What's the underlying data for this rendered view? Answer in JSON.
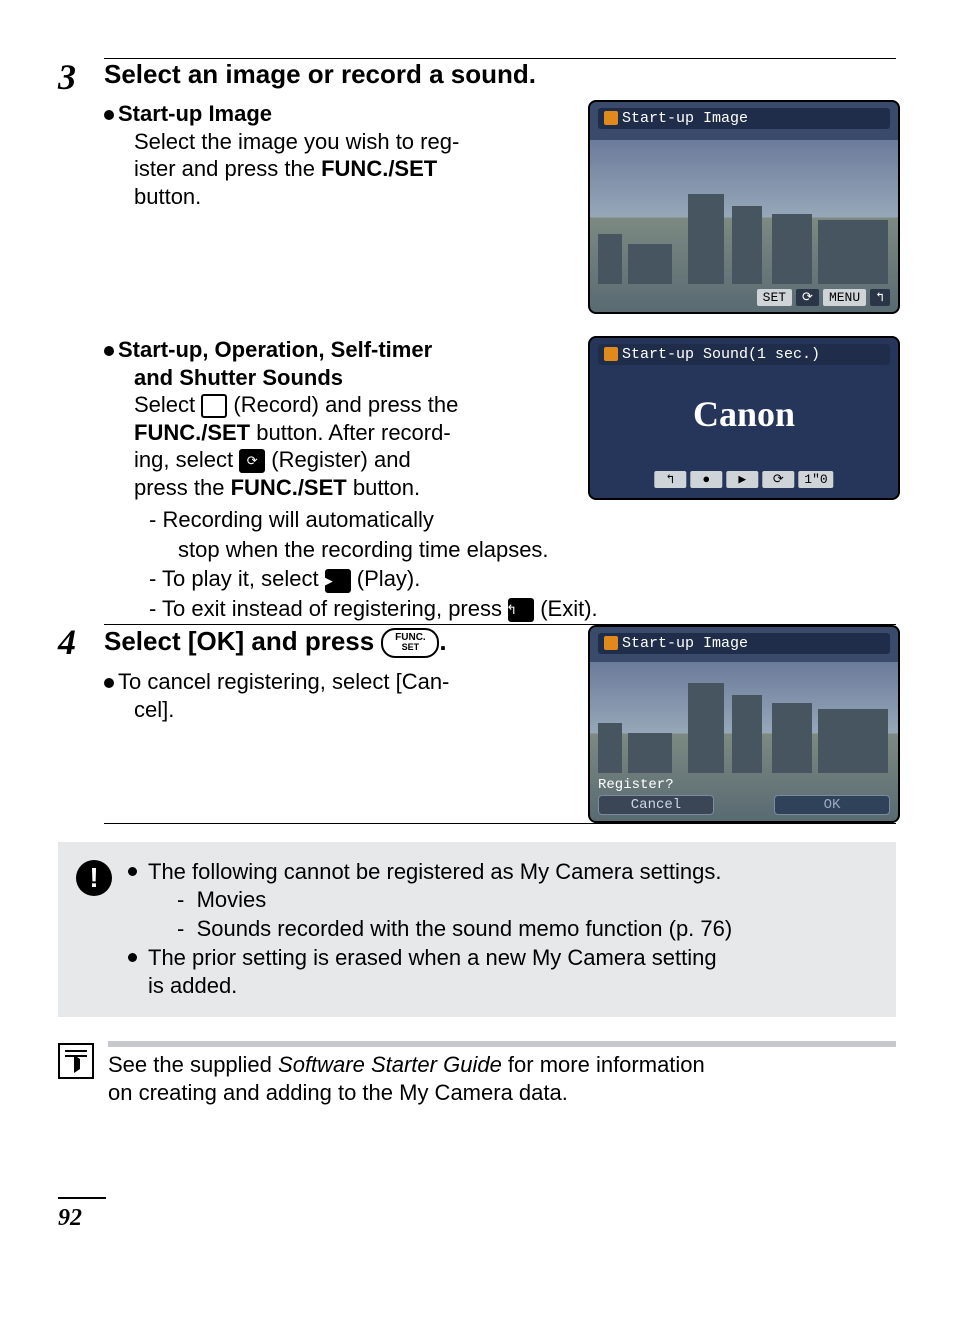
{
  "page_number": "92",
  "step3": {
    "num": "3",
    "title": "Select an image or record a sound.",
    "b1_head": "Start-up Image",
    "b1_text_a": "Select the image you wish to reg-",
    "b1_text_b": "ister and press the ",
    "b1_bold": "FUNC./SET",
    "b1_text_c": "button.",
    "screen1_title": "Start-up Image",
    "screen1_chip1": "SET",
    "screen1_chip2": "MENU",
    "b2_head_a": "Start-up, Operation, Self-timer",
    "b2_head_b": "and Shutter Sounds",
    "b2_l1a": "Select ",
    "b2_l1b": " (Record) and press the",
    "b2_l2a": "FUNC./SET",
    "b2_l2b": " button. After record-",
    "b2_l3a": "ing, select ",
    "b2_l3b": " (Register) and",
    "b2_l4a": "press the ",
    "b2_l4b": "FUNC./SET",
    "b2_l4c": " button.",
    "b2_d1a": "Recording will automatically",
    "b2_d1b": "stop when the recording time elapses.",
    "b2_d2a": "To play it, select ",
    "b2_d2b": " (Play).",
    "b2_d3a": "To exit instead of registering, press ",
    "b2_d3b": " (Exit).",
    "screen2_title": "Start-up Sound(1 sec.)",
    "screen2_brand": "Canon",
    "screen2_chip1": "↰",
    "screen2_chip2": "●",
    "screen2_chip3": "▶",
    "screen2_chip4": "⟳",
    "screen2_chip5": "1\"0"
  },
  "step4": {
    "num": "4",
    "title_a": "Select [OK] and press ",
    "title_b": ".",
    "func_top": "FUNC.",
    "func_bot": "SET",
    "p1a": "To cancel registering, select [Can-",
    "p1b": "cel].",
    "screen3_title": "Start-up Image",
    "screen3_reg": "Register?",
    "screen3_cancel": "Cancel",
    "screen3_ok": "OK"
  },
  "note": {
    "l1": "The following cannot be registered as My Camera settings.",
    "s1": "Movies",
    "s2": "Sounds recorded with the sound memo function (p. 76)",
    "l2a": "The prior setting is erased when a new My Camera setting",
    "l2b": "is added."
  },
  "ref": {
    "a": "See the supplied ",
    "book": "Software Starter Guide",
    "b": " for more information",
    "c": "on creating and adding to the My Camera data."
  },
  "icons": {
    "record": " ",
    "register": "⟳",
    "play": "▶",
    "exit": "↰"
  }
}
